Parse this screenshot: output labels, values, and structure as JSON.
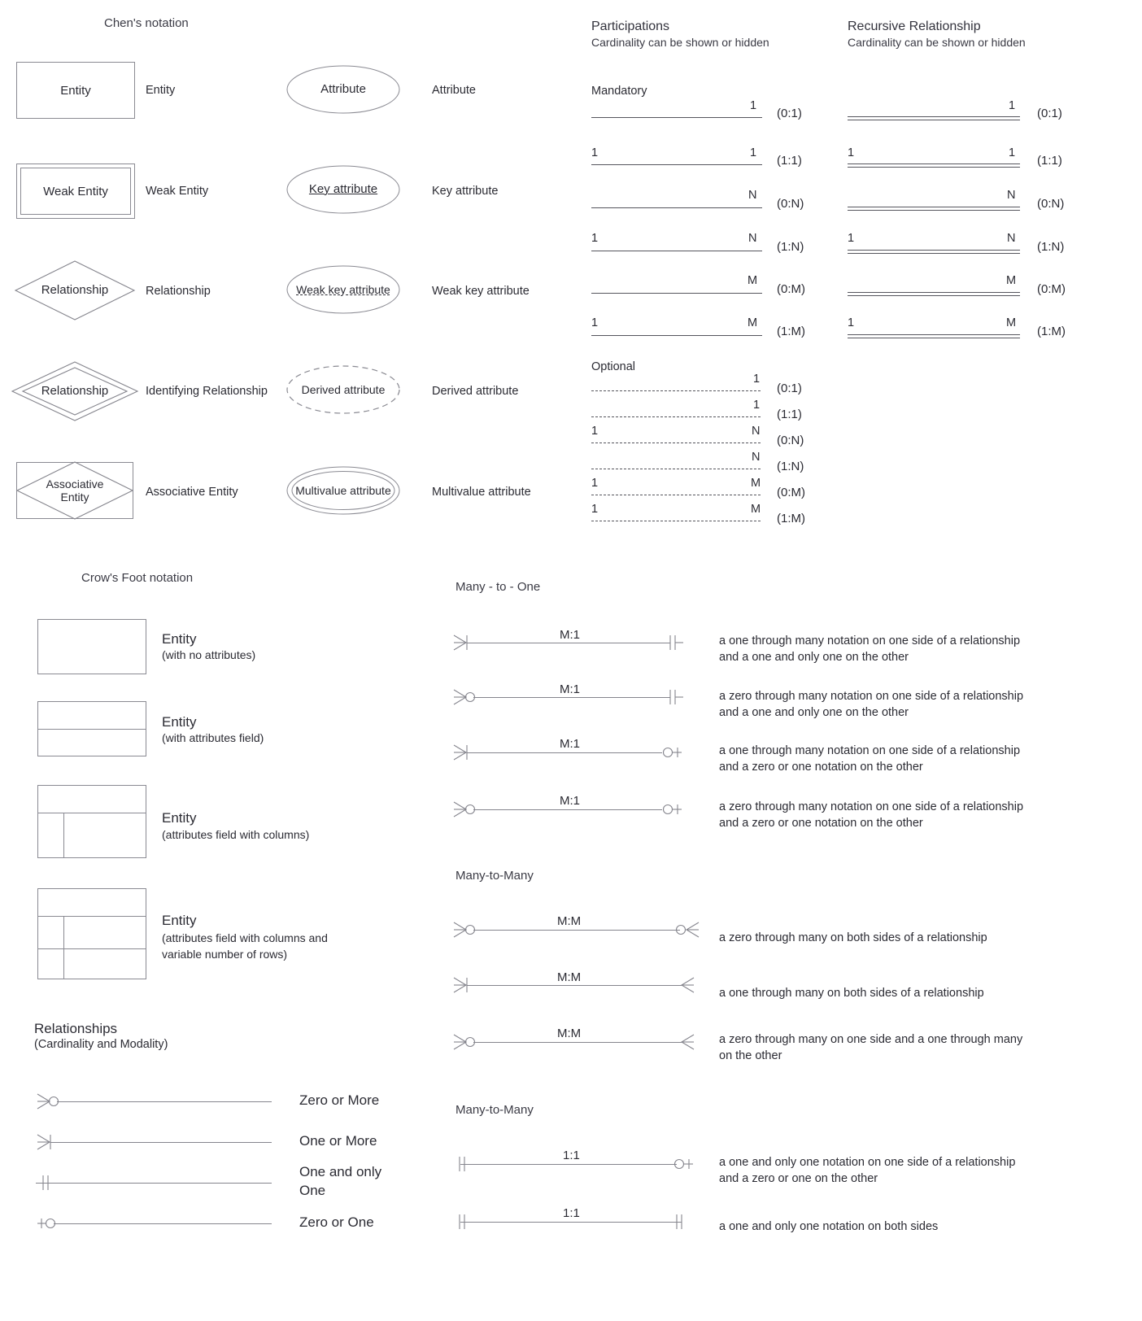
{
  "chen": {
    "title": "Chen's notation",
    "shapes": [
      {
        "shape_label": "Entity",
        "caption": "Entity"
      },
      {
        "shape_label": "Weak Entity",
        "caption": "Weak Entity"
      },
      {
        "shape_label": "Relationship",
        "caption": "Relationship"
      },
      {
        "shape_label": "Relationship",
        "caption": "Identifying Relationship"
      },
      {
        "shape_label": "Associative Entity",
        "caption": "Associative Entity"
      }
    ],
    "attributes": [
      {
        "shape_label": "Attribute",
        "caption": "Attribute"
      },
      {
        "shape_label": "Key attribute",
        "caption": "Key attribute"
      },
      {
        "shape_label": "Weak key attribute",
        "caption": "Weak key attribute"
      },
      {
        "shape_label": "Derived attribute",
        "caption": "Derived attribute"
      },
      {
        "shape_label": "Multivalue attribute",
        "caption": "Multivalue attribute"
      }
    ]
  },
  "participations": {
    "title": "Participations",
    "subtitle": "Cardinality can be shown or hidden",
    "mandatory_label": "Mandatory",
    "optional_label": "Optional",
    "mandatory_rows": [
      {
        "left": "",
        "right": "1",
        "paren": "(0:1)"
      },
      {
        "left": "1",
        "right": "1",
        "paren": "(1:1)"
      },
      {
        "left": "",
        "right": "N",
        "paren": "(0:N)"
      },
      {
        "left": "1",
        "right": "N",
        "paren": "(1:N)"
      },
      {
        "left": "",
        "right": "M",
        "paren": "(0:M)"
      },
      {
        "left": "1",
        "right": "M",
        "paren": "(1:M)"
      }
    ],
    "optional_rows": [
      {
        "left": "",
        "right": "1",
        "paren": "(0:1)"
      },
      {
        "left": "",
        "right": "1",
        "paren": "(1:1)"
      },
      {
        "left": "1",
        "right": "N",
        "paren": "(0:N)"
      },
      {
        "left": "",
        "right": "N",
        "paren": "(1:N)"
      },
      {
        "left": "1",
        "right": "M",
        "paren": "(0:M)"
      },
      {
        "left": "1",
        "right": "M",
        "paren": "(1:M)"
      }
    ]
  },
  "recursive": {
    "title": "Recursive Relationship",
    "subtitle": "Cardinality can be shown or hidden",
    "rows": [
      {
        "left": "",
        "right": "1",
        "paren": "(0:1)"
      },
      {
        "left": "1",
        "right": "1",
        "paren": "(1:1)"
      },
      {
        "left": "",
        "right": "N",
        "paren": "(0:N)"
      },
      {
        "left": "1",
        "right": "N",
        "paren": "(1:N)"
      },
      {
        "left": "",
        "right": "M",
        "paren": "(0:M)"
      },
      {
        "left": "1",
        "right": "M",
        "paren": "(1:M)"
      }
    ]
  },
  "crowsfoot": {
    "title": "Crow's Foot notation",
    "entities": [
      {
        "name": "Entity",
        "note": "(with no attributes)"
      },
      {
        "name": "Entity",
        "note": "(with attributes field)"
      },
      {
        "name": "Entity",
        "note": "(attributes field with columns)"
      },
      {
        "name": "Entity",
        "note": "(attributes field with columns and\nvariable number of rows)"
      }
    ],
    "relationships_title": "Relationships",
    "relationships_subtitle": "(Cardinality and Modality)",
    "modality": [
      {
        "label": "Zero or More",
        "glyph": "crowfoot-circle"
      },
      {
        "label": "One or More",
        "glyph": "crowfoot-bar"
      },
      {
        "label": "One and only\nOne",
        "glyph": "double-bar"
      },
      {
        "label": "Zero or One",
        "glyph": "bar-circle"
      }
    ]
  },
  "many_to_one": {
    "title": "Many - to - One",
    "rows": [
      {
        "label": "M:1",
        "left_glyph": "crowfoot-bar",
        "right_glyph": "double-bar",
        "description": "a one through many notation on one side of a relationship\nand a one and only one on the other"
      },
      {
        "label": "M:1",
        "left_glyph": "crowfoot-circle",
        "right_glyph": "double-bar",
        "description": "a zero through many notation on one side of a relationship\nand a one and only one on the other"
      },
      {
        "label": "M:1",
        "left_glyph": "crowfoot-bar",
        "right_glyph": "circle-bar",
        "description": "a one through many notation on one side of a relationship\nand a zero or one notation on the other"
      },
      {
        "label": "M:1",
        "left_glyph": "crowfoot-circle",
        "right_glyph": "circle-bar",
        "description": "a zero through many notation on one side of a relationship\nand a zero or one notation on the other"
      }
    ]
  },
  "many_to_many": {
    "title": "Many-to-Many",
    "rows": [
      {
        "label": "M:M",
        "left_glyph": "crowfoot-circle",
        "right_glyph": "circle-crowfoot",
        "description": "a zero through many on both sides of a relationship"
      },
      {
        "label": "M:M",
        "left_glyph": "crowfoot-bar",
        "right_glyph": "crowfoot-only",
        "description": "a one through many on both sides of a relationship"
      },
      {
        "label": "M:M",
        "left_glyph": "crowfoot-circle",
        "right_glyph": "crowfoot-only",
        "description": "a zero through many on one side and a one through many\non the other"
      }
    ]
  },
  "one_to_one": {
    "title": "Many-to-Many",
    "rows": [
      {
        "label": "1:1",
        "left_glyph": "double-bar",
        "right_glyph": "circle-bar",
        "description": "a one and only one notation on one side of a relationship\nand a zero or one on the other"
      },
      {
        "label": "1:1",
        "left_glyph": "double-bar",
        "right_glyph": "double-bar",
        "description": "a one and only one notation on both sides"
      }
    ]
  },
  "colors": {
    "stroke": "#85858d",
    "text": "#2b2b33",
    "line": "#55555d"
  }
}
